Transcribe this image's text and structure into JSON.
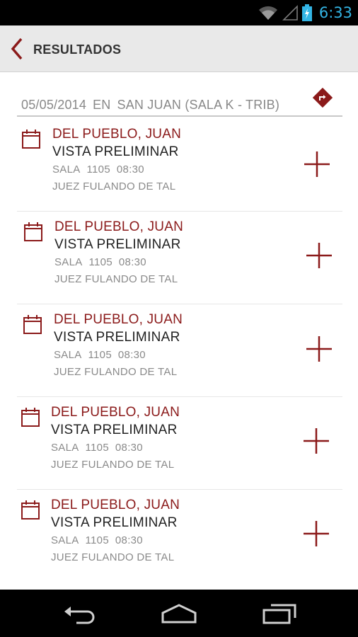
{
  "status_bar": {
    "time": "6:33",
    "icons": [
      "wifi-icon",
      "signal-icon",
      "battery-charging-icon"
    ],
    "time_color": "#33b5e5"
  },
  "action_bar": {
    "title": "RESULTADOS",
    "back_icon": "chevron-left-icon"
  },
  "filter": {
    "date": "05/05/2014",
    "connector": "EN",
    "location": "SAN JUAN (SALA K - TRIB)",
    "directions_icon": "directions-icon"
  },
  "results": [
    {
      "name": "DEL PUEBLO, JUAN",
      "type": "VISTA PRELIMINAR",
      "sala_label": "SALA",
      "sala_number": "1105",
      "time": "08:30",
      "judge": "JUEZ FULANDO DE TAL"
    },
    {
      "name": "DEL PUEBLO, JUAN",
      "type": "VISTA PRELIMINAR",
      "sala_label": "SALA",
      "sala_number": "1105",
      "time": "08:30",
      "judge": "JUEZ FULANDO DE TAL"
    },
    {
      "name": "DEL PUEBLO, JUAN",
      "type": "VISTA PRELIMINAR",
      "sala_label": "SALA",
      "sala_number": "1105",
      "time": "08:30",
      "judge": "JUEZ FULANDO DE TAL"
    },
    {
      "name": "DEL PUEBLO, JUAN",
      "type": "VISTA PRELIMINAR",
      "sala_label": "SALA",
      "sala_number": "1105",
      "time": "08:30",
      "judge": "JUEZ FULANDO DE TAL"
    },
    {
      "name": "DEL PUEBLO, JUAN",
      "type": "VISTA PRELIMINAR",
      "sala_label": "SALA",
      "sala_number": "1105",
      "time": "08:30",
      "judge": "JUEZ FULANDO DE TAL"
    }
  ],
  "nav_bar": {
    "icons": [
      "back-nav-icon",
      "home-nav-icon",
      "recent-apps-icon"
    ]
  },
  "colors": {
    "accent": "#8b1a1a",
    "action_bar_bg": "#e9e9e9"
  }
}
